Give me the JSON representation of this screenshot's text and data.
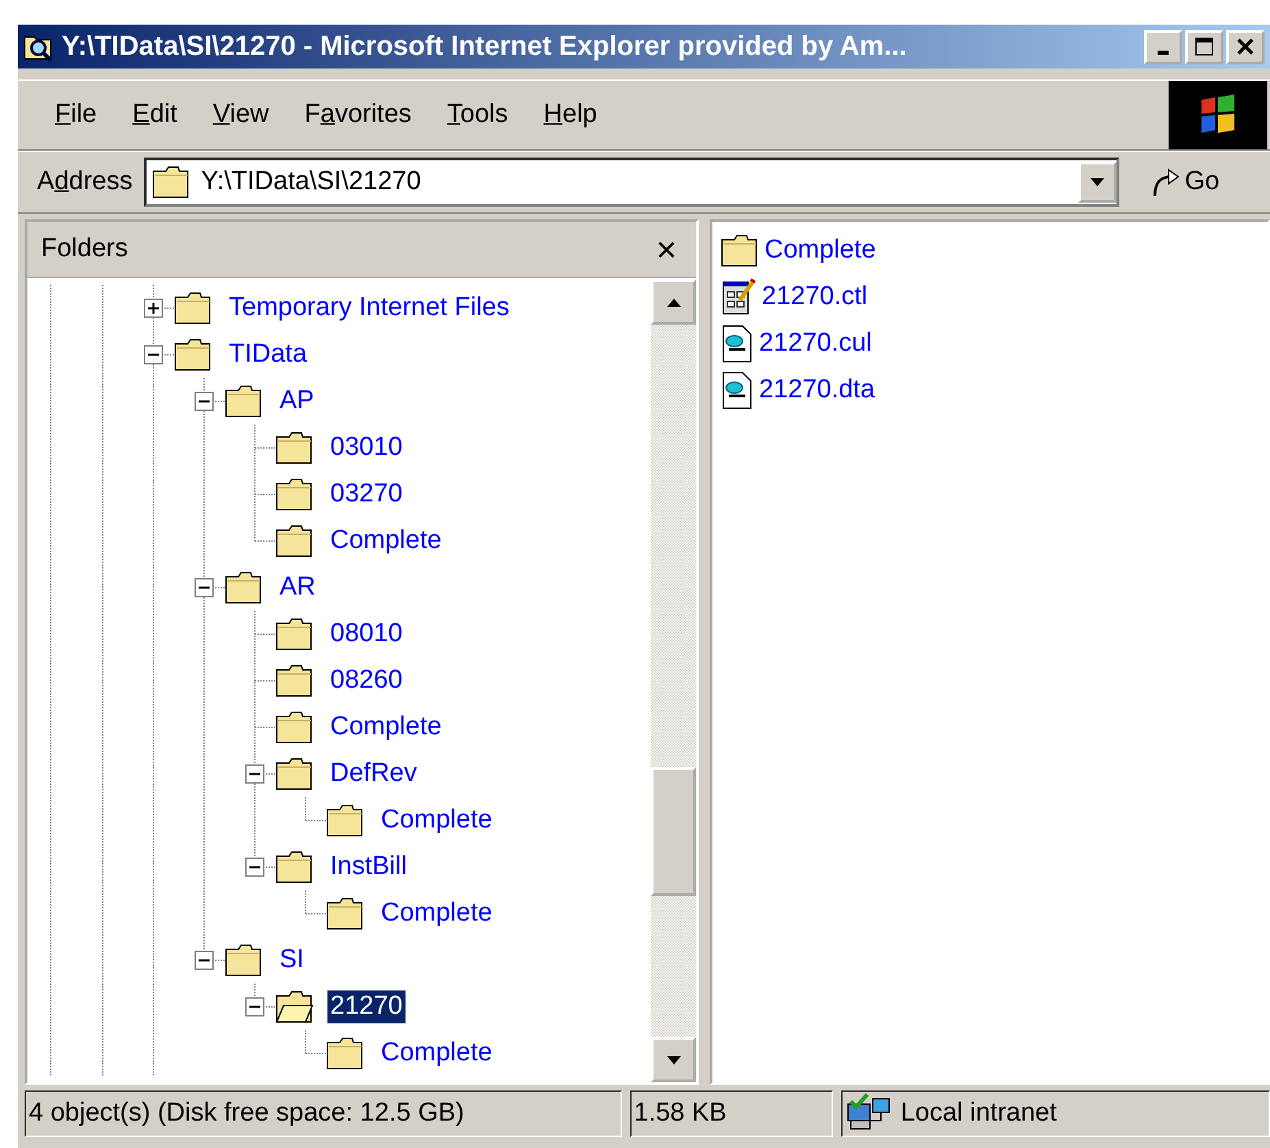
{
  "window": {
    "title": "Y:\\TIData\\SI\\21270 - Microsoft Internet Explorer provided by Am..."
  },
  "menu": [
    {
      "key": "F",
      "post": "ile"
    },
    {
      "key": "E",
      "post": "dit"
    },
    {
      "key": "V",
      "post": "iew"
    },
    {
      "pre": "F",
      "key": "a",
      "post": "vorites"
    },
    {
      "key": "T",
      "post": "ools"
    },
    {
      "key": "H",
      "post": "elp"
    }
  ],
  "address": {
    "label": {
      "pre": "A",
      "key": "d",
      "post": "dress"
    },
    "value": "Y:\\TIData\\SI\\21270",
    "go": "Go"
  },
  "folders_pane": {
    "title": "Folders",
    "close": "×",
    "tree": [
      {
        "label": "Temporary Internet Files",
        "expanded": false,
        "selected": false
      },
      {
        "label": "TIData",
        "expanded": true,
        "selected": false,
        "children": [
          {
            "label": "AP",
            "expanded": true,
            "selected": false,
            "children": [
              {
                "label": "03010",
                "selected": false
              },
              {
                "label": "03270",
                "selected": false
              },
              {
                "label": "Complete",
                "selected": false
              }
            ]
          },
          {
            "label": "AR",
            "expanded": true,
            "selected": false,
            "children": [
              {
                "label": "08010",
                "selected": false
              },
              {
                "label": "08260",
                "selected": false
              },
              {
                "label": "Complete",
                "selected": false
              },
              {
                "label": "DefRev",
                "expanded": true,
                "selected": false,
                "children": [
                  {
                    "label": "Complete",
                    "selected": false
                  }
                ]
              },
              {
                "label": "InstBill",
                "expanded": true,
                "selected": false,
                "children": [
                  {
                    "label": "Complete",
                    "selected": false
                  }
                ]
              }
            ]
          },
          {
            "label": "SI",
            "expanded": true,
            "selected": false,
            "children": [
              {
                "label": "21270",
                "expanded": true,
                "selected": true,
                "children": [
                  {
                    "label": "Complete",
                    "selected": false
                  }
                ]
              }
            ]
          }
        ]
      }
    ]
  },
  "files": [
    {
      "name": "Complete",
      "kind": "folder"
    },
    {
      "name": "21270.ctl",
      "kind": "control"
    },
    {
      "name": "21270.cul",
      "kind": "document"
    },
    {
      "name": "21270.dta",
      "kind": "document"
    }
  ],
  "status_bar": {
    "objects": "4 object(s) (Disk free space: 12.5 GB)",
    "size": "1.58 KB",
    "zone": "Local intranet"
  }
}
